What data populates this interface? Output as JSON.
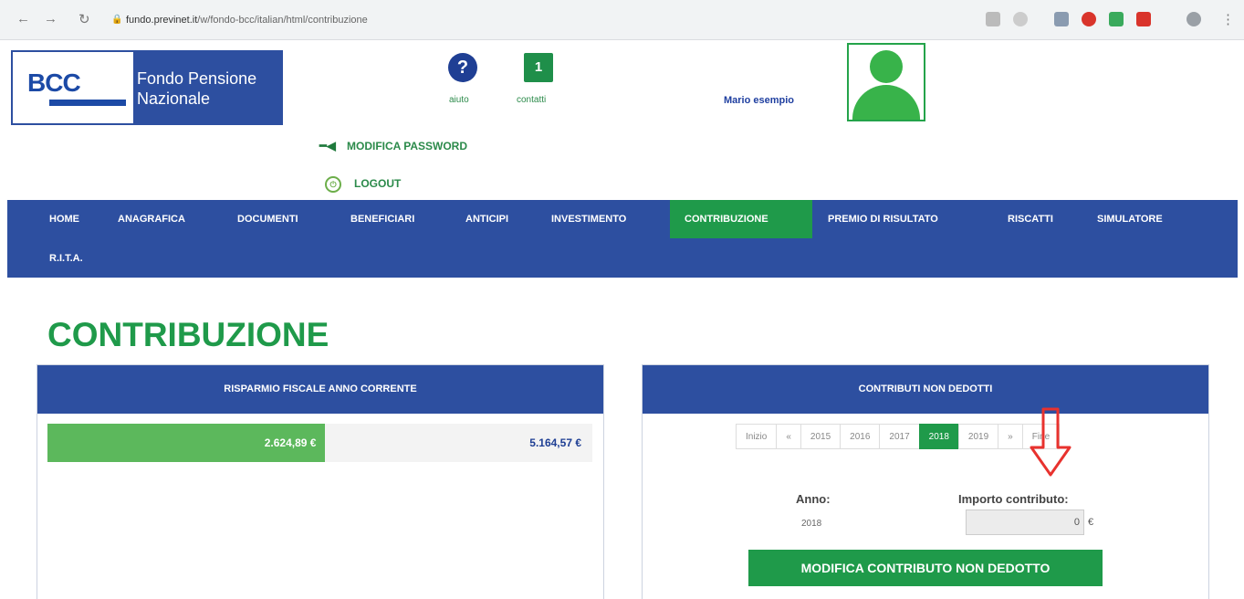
{
  "browser": {
    "url_host": "fundo.previnet.it",
    "url_path": "/w/fondo-bcc/italian/html/contribuzione"
  },
  "header": {
    "logo_brand": "BCC",
    "logo_text": "Fondo Pensione Nazionale",
    "help_label": "aiuto",
    "help_glyph": "?",
    "contacts_label": "contatti",
    "contacts_glyph": "1",
    "user_name": "Mario esempio",
    "change_password": "MODIFICA PASSWORD",
    "logout": "LOGOUT"
  },
  "nav": {
    "items": [
      "HOME",
      "ANAGRAFICA",
      "DOCUMENTI",
      "BENEFICIARI",
      "ANTICIPI",
      "INVESTIMENTO",
      "CONTRIBUZIONE",
      "PREMIO DI RISULTATO",
      "RISCATTI",
      "SIMULATORE",
      "R.I.T.A."
    ],
    "active": "CONTRIBUZIONE"
  },
  "page": {
    "title": "CONTRIBUZIONE"
  },
  "savings_panel": {
    "title": "RISPARMIO FISCALE ANNO CORRENTE",
    "current_value": "2.624,89 €",
    "max_value": "5.164,57 €",
    "fill_fraction": 0.51
  },
  "contrib_panel": {
    "title": "CONTRIBUTI NON DEDOTTI",
    "pagination": [
      "Inizio",
      "«",
      "2015",
      "2016",
      "2017",
      "2018",
      "2019",
      "»",
      "Fine"
    ],
    "active_page": "2018",
    "year_label": "Anno:",
    "year_value": "2018",
    "amount_label": "Importo contributo:",
    "amount_value": "0",
    "currency": "€",
    "button_label": "MODIFICA CONTRIBUTO NON DEDOTTO"
  },
  "colors": {
    "brand_blue": "#2d4fa0",
    "brand_green": "#1f9a4a",
    "annotation_arrow": "#e8322e"
  }
}
